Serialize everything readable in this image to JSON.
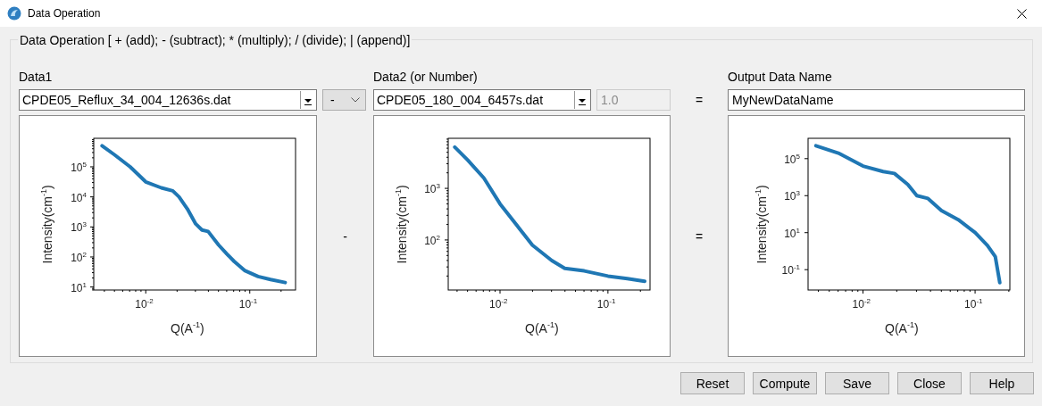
{
  "window": {
    "title": "Data Operation"
  },
  "group": {
    "title": "Data Operation [ + (add); - (subtract); * (multiply); / (divide); | (append)]"
  },
  "data1": {
    "label": "Data1",
    "value": "CPDE05_Reflux_34_004_12636s.dat",
    "plot": {
      "xlabel": "Q(A$^{-1}$)",
      "ylabel": "Intensity(cm$^{-1}$)",
      "xtick_labels": [
        "10$^{-2}$",
        "10$^{-1}$"
      ],
      "ytick_labels": [
        "10$^{5}$",
        "10$^{4}$",
        "10$^{3}$",
        "10$^{2}$",
        "10$^{1}$"
      ]
    }
  },
  "operator": {
    "value": "-",
    "sign": "-"
  },
  "data2": {
    "label": "Data2 (or Number)",
    "value": "CPDE05_180_004_6457s.dat",
    "number": {
      "value": "1.0",
      "disabled": true
    },
    "plot": {
      "xlabel": "Q(A$^{-1}$)",
      "ylabel": "Intensity(cm$^{-1}$)",
      "xtick_labels": [
        "10$^{-2}$",
        "10$^{-1}$"
      ],
      "ytick_labels": [
        "10$^{3}$",
        "10$^{2}$"
      ]
    }
  },
  "equals": {
    "row_sign": "=",
    "plot_sign": "="
  },
  "output": {
    "label": "Output Data Name",
    "value": "MyNewDataName",
    "plot": {
      "xlabel": "Q(A$^{-1}$)",
      "ylabel": "Intensity(cm$^{-1}$)",
      "xtick_labels": [
        "10$^{-2}$",
        "10$^{-1}$"
      ],
      "ytick_labels": [
        "10$^{5}$",
        "10$^{3}$",
        "10$^{1}$",
        "10$^{-1}$"
      ]
    }
  },
  "buttons": [
    "Reset",
    "Compute",
    "Save",
    "Close",
    "Help"
  ]
}
